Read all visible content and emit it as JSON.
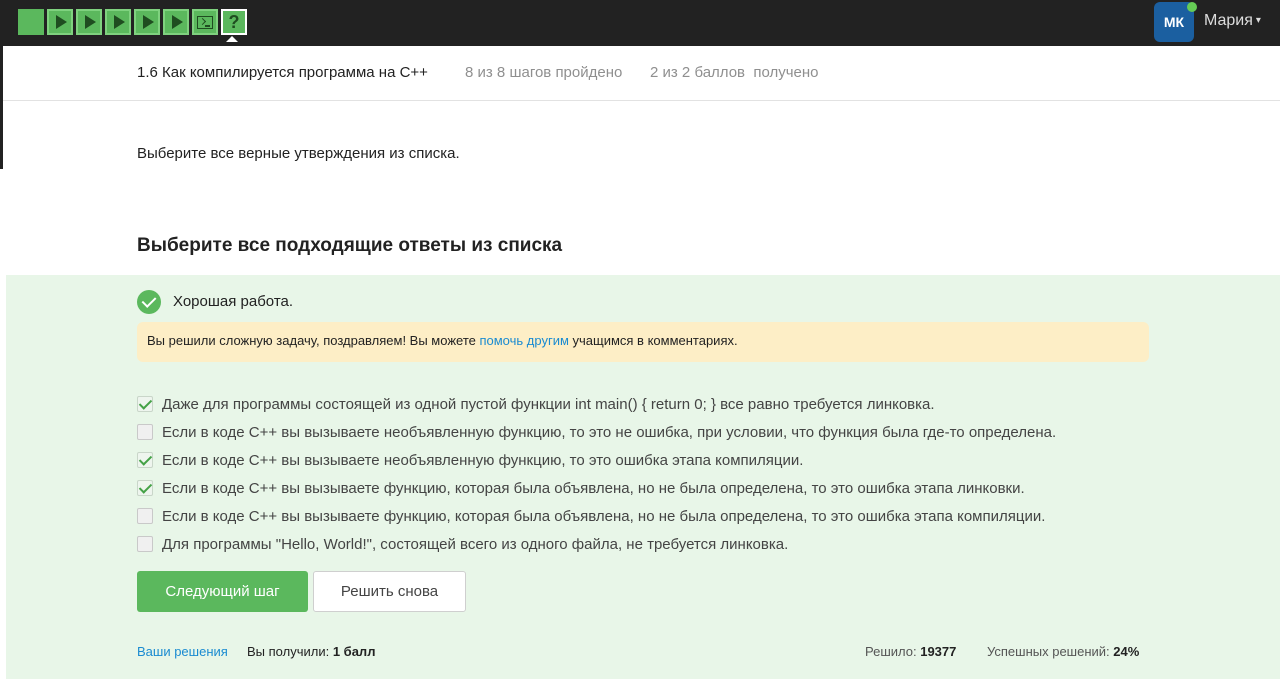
{
  "topbar": {
    "steps": [
      {
        "icon": "square-step-icon",
        "state": "completed"
      },
      {
        "icon": "play-icon",
        "state": "completed"
      },
      {
        "icon": "play-icon",
        "state": "completed"
      },
      {
        "icon": "play-icon",
        "state": "completed"
      },
      {
        "icon": "play-icon",
        "state": "completed"
      },
      {
        "icon": "play-icon",
        "state": "completed"
      },
      {
        "icon": "terminal-icon",
        "state": "completed"
      },
      {
        "icon": "question-icon",
        "state": "active"
      }
    ],
    "question_glyph": "?",
    "avatar_initials": "МК",
    "username": "Мария"
  },
  "lesson": {
    "title": "1.6 Как компилируется программа на C++",
    "progress": "8 из 8 шагов пройдено",
    "score": "2 из 2 баллов  получено"
  },
  "instruction": "Выберите все верные утверждения из списка.",
  "quiz_heading": "Выберите все подходящие ответы из списка",
  "feedback": {
    "title": "Хорошая работа.",
    "notice_before": "Вы решили сложную задачу, поздравляем! Вы можете ",
    "notice_link": "помочь другим",
    "notice_after": " учащимся в комментариях."
  },
  "options": [
    {
      "text": "Даже для программы состоящей из одной пустой функции int main() { return 0; } все равно требуется линковка.",
      "checked": true
    },
    {
      "text": "Если в коде C++ вы вызываете необъявленную функцию, то это не ошибка, при условии, что функция была где-то определена.",
      "checked": false
    },
    {
      "text": "Если в коде C++ вы вызываете необъявленную функцию, то это ошибка этапа компиляции.",
      "checked": true
    },
    {
      "text": "Если в коде C++ вы вызываете функцию, которая была объявлена, но не была определена, то это ошибка этапа линковки.",
      "checked": true
    },
    {
      "text": "Если в коде C++ вы вызываете функцию, которая была объявлена, но не была определена, то это ошибка этапа компиляции.",
      "checked": false
    },
    {
      "text": "Для программы \"Hello, World!\", состоящей всего из одного файла, не требуется линковка.",
      "checked": false
    }
  ],
  "buttons": {
    "next": "Следующий шаг",
    "retry": "Решить снова"
  },
  "footer": {
    "solutions_link": "Ваши решения",
    "got_label": "Вы получили:",
    "got_value": "1 балл",
    "solved_label": "Решило:",
    "solved_value": "19377",
    "success_label": "Успешных решений:",
    "success_value": "24%"
  }
}
